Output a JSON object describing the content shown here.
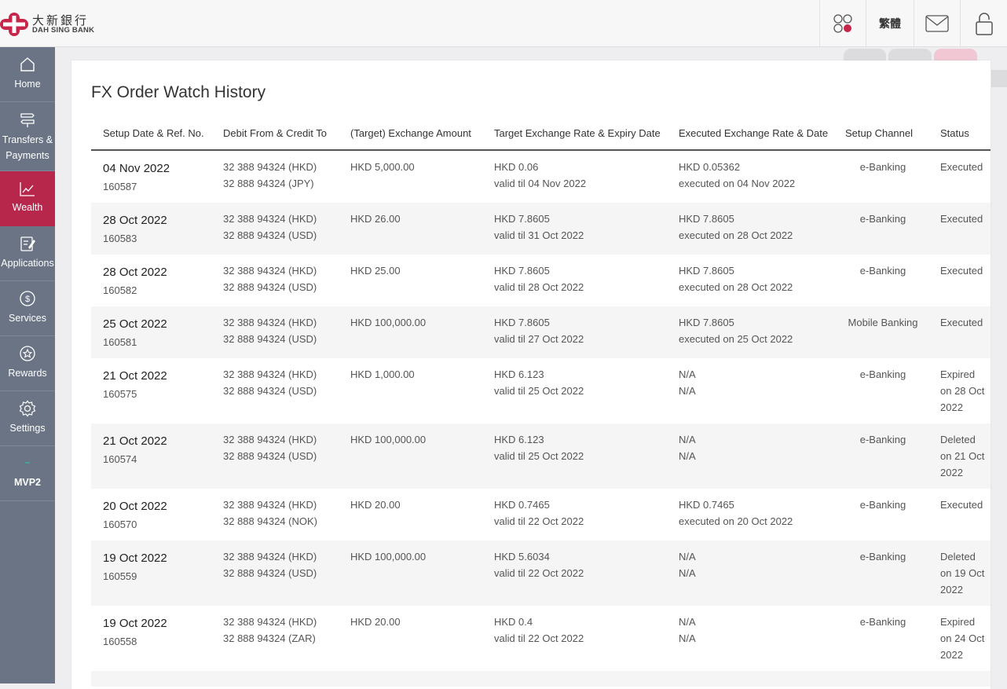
{
  "header": {
    "logo_cn": "大新銀行",
    "logo_en": "DAH SING BANK",
    "language_label": "繁體",
    "icons": [
      "apps-icon",
      "mail-icon",
      "lock-icon"
    ]
  },
  "sidebar": {
    "items": [
      {
        "label": "Home",
        "icon": "home-icon"
      },
      {
        "label": "Transfers & Payments",
        "icon": "transfer-icon"
      },
      {
        "label": "Wealth",
        "icon": "chart-icon",
        "active": true
      },
      {
        "label": "Applications",
        "icon": "form-icon"
      },
      {
        "label": "Services",
        "icon": "dollar-icon"
      },
      {
        "label": "Rewards",
        "icon": "star-icon"
      },
      {
        "label": "Settings",
        "icon": "gear-icon"
      },
      {
        "label": "MVP2",
        "icon": "dash-icon"
      }
    ]
  },
  "colors": {
    "brand": "#c8254a",
    "sidebar_bg": "#6a7484",
    "active_bg": "#b7274c"
  },
  "main": {
    "title": "FX Order Watch History",
    "columns": [
      "Setup Date & Ref. No.",
      "Debit From & Credit To",
      "(Target) Exchange Amount",
      "Target Exchange Rate & Expiry Date",
      "Executed Exchange Rate & Date",
      "Setup Channel",
      "Status"
    ],
    "rows": [
      {
        "date": "04 Nov 2022",
        "ref": "160587",
        "debit": "32 388 94324 (HKD)",
        "credit": "32 888 94324 (JPY)",
        "amount": "HKD 5,000.00",
        "target_rate": "HKD 0.06",
        "expiry": "valid til 04 Nov 2022",
        "exec_rate": "HKD 0.05362",
        "exec_date": "executed on 04 Nov 2022",
        "channel": "e-Banking",
        "status": "Executed"
      },
      {
        "date": "28 Oct 2022",
        "ref": "160583",
        "debit": "32 388 94324 (HKD)",
        "credit": "32 888 94324 (USD)",
        "amount": "HKD 26.00",
        "target_rate": "HKD 7.8605",
        "expiry": "valid til 31 Oct 2022",
        "exec_rate": "HKD 7.8605",
        "exec_date": "executed on 28 Oct 2022",
        "channel": "e-Banking",
        "status": "Executed"
      },
      {
        "date": "28 Oct 2022",
        "ref": "160582",
        "debit": "32 388 94324 (HKD)",
        "credit": "32 888 94324 (USD)",
        "amount": "HKD 25.00",
        "target_rate": "HKD 7.8605",
        "expiry": "valid til 28 Oct 2022",
        "exec_rate": "HKD 7.8605",
        "exec_date": "executed on 28 Oct 2022",
        "channel": "e-Banking",
        "status": "Executed"
      },
      {
        "date": "25 Oct 2022",
        "ref": "160581",
        "debit": "32 388 94324 (HKD)",
        "credit": "32 888 94324 (USD)",
        "amount": "HKD 100,000.00",
        "target_rate": "HKD 7.8605",
        "expiry": "valid til 27 Oct 2022",
        "exec_rate": "HKD 7.8605",
        "exec_date": "executed on 25 Oct 2022",
        "channel": "Mobile Banking",
        "status": "Executed"
      },
      {
        "date": "21 Oct 2022",
        "ref": "160575",
        "debit": "32 388 94324 (HKD)",
        "credit": "32 888 94324 (USD)",
        "amount": "HKD 1,000.00",
        "target_rate": "HKD 6.123",
        "expiry": "valid til 25 Oct 2022",
        "exec_rate": "N/A",
        "exec_date": "N/A",
        "channel": "e-Banking",
        "status": "Expired on 28 Oct 2022"
      },
      {
        "date": "21 Oct 2022",
        "ref": "160574",
        "debit": "32 388 94324 (HKD)",
        "credit": "32 888 94324 (USD)",
        "amount": "HKD 100,000.00",
        "target_rate": "HKD 6.123",
        "expiry": "valid til 25 Oct 2022",
        "exec_rate": "N/A",
        "exec_date": "N/A",
        "channel": "e-Banking",
        "status": "Deleted on 21 Oct 2022"
      },
      {
        "date": "20 Oct 2022",
        "ref": "160570",
        "debit": "32 388 94324 (HKD)",
        "credit": "32 888 94324 (NOK)",
        "amount": "HKD 20.00",
        "target_rate": "HKD 0.7465",
        "expiry": "valid til 22 Oct 2022",
        "exec_rate": "HKD 0.7465",
        "exec_date": "executed on 20 Oct 2022",
        "channel": "e-Banking",
        "status": "Executed"
      },
      {
        "date": "19 Oct 2022",
        "ref": "160559",
        "debit": "32 388 94324 (HKD)",
        "credit": "32 888 94324 (USD)",
        "amount": "HKD 100,000.00",
        "target_rate": "HKD 5.6034",
        "expiry": "valid til 22 Oct 2022",
        "exec_rate": "N/A",
        "exec_date": "N/A",
        "channel": "e-Banking",
        "status": "Deleted on 19 Oct 2022"
      },
      {
        "date": "19 Oct 2022",
        "ref": "160558",
        "debit": "32 388 94324 (HKD)",
        "credit": "32 888 94324 (ZAR)",
        "amount": "HKD 20.00",
        "target_rate": "HKD 0.4",
        "expiry": "valid til 22 Oct 2022",
        "exec_rate": "N/A",
        "exec_date": "N/A",
        "channel": "e-Banking",
        "status": "Expired on 24 Oct 2022"
      }
    ]
  }
}
